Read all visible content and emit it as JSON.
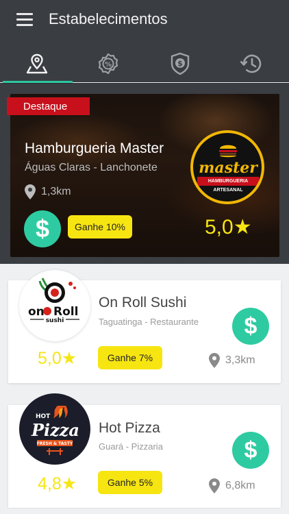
{
  "header": {
    "title": "Estabelecimentos",
    "tabs": [
      {
        "icon": "map-pin-icon",
        "active": true
      },
      {
        "icon": "percent-badge-icon",
        "active": false
      },
      {
        "icon": "dollar-badge-icon",
        "active": false
      },
      {
        "icon": "history-icon",
        "active": false
      }
    ],
    "accent_color": "#2cc7a0"
  },
  "featured": {
    "badge": "Destaque",
    "name": "Hamburgueria Master",
    "subtitle": "Águas Claras - Lanchonete",
    "distance": "1,3km",
    "cashback": "Ganhe 10%",
    "rating": "5,0★",
    "logo": {
      "word": "master",
      "band": "HAMBURGUERIA ARTESANAL"
    }
  },
  "establishments": [
    {
      "name": "On Roll Sushi",
      "subtitle": "Taguatinga - Restaurante",
      "rating": "5,0★",
      "cashback": "Ganhe 7%",
      "distance": "3,3km",
      "logo": {
        "word1": "on",
        "word2": "Roll",
        "word3": "sushi"
      }
    },
    {
      "name": "Hot Pizza",
      "subtitle": "Guará - Pizzaria",
      "rating": "4,8★",
      "cashback": "Ganhe 5%",
      "distance": "6,8km",
      "logo": {
        "word1": "HOT",
        "word2": "Pizza",
        "word3": "FRESH & TASTY"
      }
    }
  ],
  "colors": {
    "highlight": "#f7e512",
    "cashback_green": "#2ecba2",
    "badge_red": "#c8101c"
  }
}
